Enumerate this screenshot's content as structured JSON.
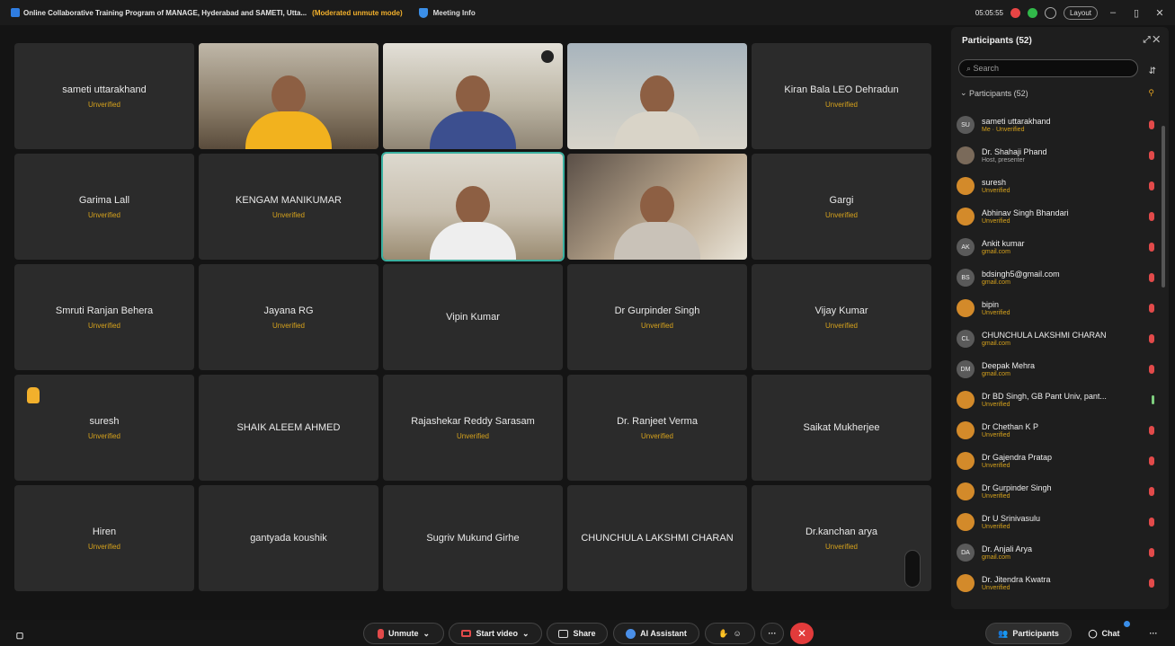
{
  "topbar": {
    "title": "Online Collaborative Training Program of MANAGE, Hyderabad and SAMETI, Utta...",
    "mode": "(Moderated unmute mode)",
    "meeting_info": "Meeting Info",
    "timer": "05:05:55",
    "layout_label": "Layout"
  },
  "tiles": [
    {
      "name": "sameti uttarakhand",
      "status": "Unverified"
    },
    {
      "video": true,
      "scene": "v1"
    },
    {
      "video": true,
      "scene": "v2"
    },
    {
      "video": true,
      "scene": "v3"
    },
    {
      "name": "Kiran Bala LEO Dehradun",
      "status": "Unverified"
    },
    {
      "name": "Garima Lall",
      "status": "Unverified"
    },
    {
      "name": "KENGAM MANIKUMAR",
      "status": "Unverified"
    },
    {
      "video": true,
      "scene": "v4",
      "active": true
    },
    {
      "video": true,
      "scene": "v5"
    },
    {
      "name": "Gargi",
      "status": "Unverified"
    },
    {
      "name": "Smruti Ranjan Behera",
      "status": "Unverified"
    },
    {
      "name": "Jayana RG",
      "status": "Unverified"
    },
    {
      "name": "Vipin Kumar",
      "status": ""
    },
    {
      "name": "Dr Gurpinder Singh",
      "status": "Unverified"
    },
    {
      "name": "Vijay Kumar",
      "status": "Unverified"
    },
    {
      "name": "suresh",
      "status": "Unverified",
      "hand": true
    },
    {
      "name": "SHAIK ALEEM AHMED",
      "status": ""
    },
    {
      "name": "Rajashekar Reddy Sarasam",
      "status": "Unverified"
    },
    {
      "name": "Dr. Ranjeet Verma",
      "status": "Unverified"
    },
    {
      "name": "Saikat Mukherjee",
      "status": ""
    },
    {
      "name": "Hiren",
      "status": "Unverified"
    },
    {
      "name": "gantyada koushik",
      "status": ""
    },
    {
      "name": "Sugriv Mukund Girhe",
      "status": ""
    },
    {
      "name": "CHUNCHULA LAKSHMI CHARAN",
      "status": ""
    },
    {
      "name": "Dr.kanchan arya",
      "status": "Unverified"
    }
  ],
  "panel": {
    "title": "Participants (52)",
    "search_placeholder": "Search",
    "section_label": "Participants (52)",
    "participants": [
      {
        "initials": "SU",
        "name": "sameti uttarakhand",
        "sub": "Me · Unverified",
        "grey": false
      },
      {
        "initials": "",
        "name": "Dr. Shahaji Phand",
        "sub": "Host, presenter",
        "grey": true,
        "photo": true
      },
      {
        "initials": "",
        "name": "suresh",
        "sub": "Unverified",
        "orange": true
      },
      {
        "initials": "",
        "name": "Abhinav Singh Bhandari",
        "sub": "Unverified",
        "orange": true
      },
      {
        "initials": "AK",
        "name": "Ankit kumar",
        "sub": "gmail.com"
      },
      {
        "initials": "BS",
        "name": "bdsingh5@gmail.com",
        "sub": "gmail.com"
      },
      {
        "initials": "",
        "name": "bipin",
        "sub": "Unverified",
        "orange": true
      },
      {
        "initials": "CL",
        "name": "CHUNCHULA LAKSHMI CHARAN",
        "sub": "gmail.com"
      },
      {
        "initials": "DM",
        "name": "Deepak Mehra",
        "sub": "gmail.com"
      },
      {
        "initials": "",
        "name": "Dr BD Singh, GB Pant Univ, pant...",
        "sub": "Unverified",
        "orange": true,
        "micgreen": true
      },
      {
        "initials": "",
        "name": "Dr Chethan K P",
        "sub": "Unverified",
        "orange": true
      },
      {
        "initials": "",
        "name": "Dr Gajendra Pratap",
        "sub": "Unverified",
        "orange": true
      },
      {
        "initials": "",
        "name": "Dr Gurpinder Singh",
        "sub": "Unverified",
        "orange": true
      },
      {
        "initials": "",
        "name": "Dr U Srinivasulu",
        "sub": "Unverified",
        "orange": true
      },
      {
        "initials": "DA",
        "name": "Dr. Anjali Arya",
        "sub": "gmail.com"
      },
      {
        "initials": "",
        "name": "Dr. Jitendra Kwatra",
        "sub": "Unverified",
        "orange": true
      }
    ]
  },
  "bottom": {
    "unmute": "Unmute",
    "start_video": "Start video",
    "share": "Share",
    "ai_assistant": "AI Assistant",
    "participants": "Participants",
    "chat": "Chat"
  },
  "colors": {
    "accent_red": "#e23b3b",
    "unverified": "#d6a21c",
    "active_border": "#3ab0a0"
  }
}
